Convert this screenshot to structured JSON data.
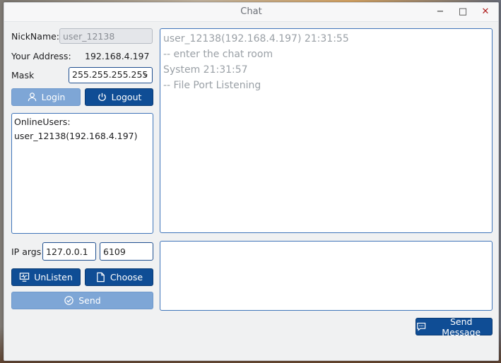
{
  "window": {
    "title": "Chat",
    "controls": {
      "minimize": "−",
      "maximize": "□",
      "close": "✕"
    }
  },
  "left_panel": {
    "nickname_label": "NickName:",
    "nickname_value": "user_12138",
    "address_label": "Your Address:",
    "address_value": "192.168.4.197",
    "mask_label": "Mask",
    "mask_value": "255.255.255.255",
    "login_label": "Login",
    "logout_label": "Logout",
    "online_users_title": "OnlineUsers:",
    "online_users": [
      "user_12138(192.168.4.197)"
    ],
    "ip_args_label": "IP args",
    "ip_value": "127.0.0.1",
    "port_value": "6109",
    "unlisten_label": "UnListen",
    "choose_label": "Choose",
    "send_label": "Send"
  },
  "chat_log": {
    "lines": [
      "user_12138(192.168.4.197)  21:31:55",
      " -- enter the chat room",
      "System  21:31:57",
      " -- File Port Listening"
    ]
  },
  "message_input": {
    "value": ""
  },
  "send_message_label": "Send Message",
  "colors": {
    "primary": "#0f4d95",
    "primary_light": "#7ea6d6",
    "border": "#3f74b9"
  }
}
